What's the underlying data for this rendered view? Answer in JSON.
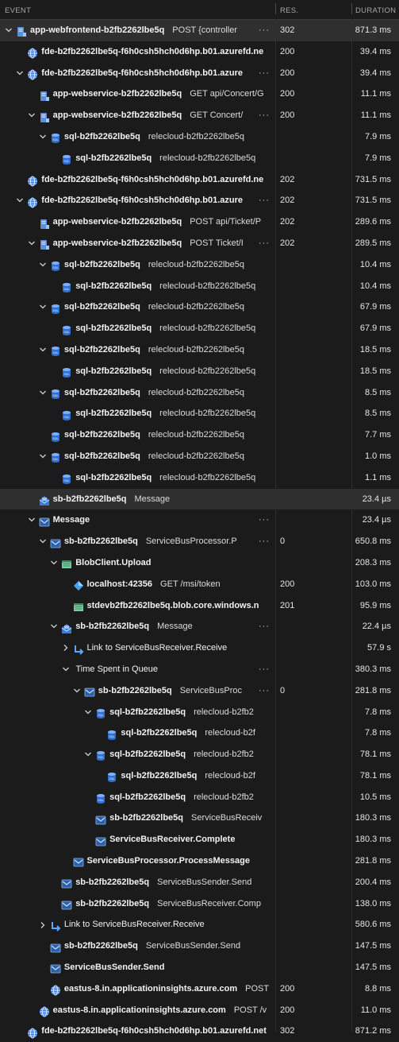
{
  "columns": {
    "event": "EVENT",
    "res": "RES.",
    "duration": "DURATION"
  },
  "rows": [
    {
      "indent": 0,
      "chevron": "down",
      "icon": "app",
      "name": "app-webfrontend-b2fb2262lbe5q",
      "op": "POST {controller",
      "dots": true,
      "res": "302",
      "dur": "871.3 ms",
      "sel": true
    },
    {
      "indent": 1,
      "chevron": "",
      "icon": "globe",
      "name": "fde-b2fb2262lbe5q-f6h0csh5hch0d6hp.b01.azurefd.ne",
      "op": "",
      "dots": false,
      "res": "200",
      "dur": "39.4 ms"
    },
    {
      "indent": 1,
      "chevron": "down",
      "icon": "globe",
      "name": "fde-b2fb2262lbe5q-f6h0csh5hch0d6hp.b01.azure",
      "op": "",
      "dots": true,
      "res": "200",
      "dur": "39.4 ms"
    },
    {
      "indent": 2,
      "chevron": "",
      "icon": "app",
      "name": "app-webservice-b2fb2262lbe5q",
      "op": "GET api/Concert/G",
      "dots": false,
      "res": "200",
      "dur": "11.1 ms"
    },
    {
      "indent": 2,
      "chevron": "down",
      "icon": "app",
      "name": "app-webservice-b2fb2262lbe5q",
      "op": "GET Concert/",
      "dots": true,
      "res": "200",
      "dur": "11.1 ms"
    },
    {
      "indent": 3,
      "chevron": "down",
      "icon": "sql",
      "name": "sql-b2fb2262lbe5q",
      "op": "relecloud-b2fb2262lbe5q",
      "dots": false,
      "res": "",
      "dur": "7.9 ms"
    },
    {
      "indent": 4,
      "chevron": "",
      "icon": "sql",
      "name": "sql-b2fb2262lbe5q",
      "op": "relecloud-b2fb2262lbe5q",
      "dots": false,
      "res": "",
      "dur": "7.9 ms"
    },
    {
      "indent": 1,
      "chevron": "",
      "icon": "globe",
      "name": "fde-b2fb2262lbe5q-f6h0csh5hch0d6hp.b01.azurefd.ne",
      "op": "",
      "dots": false,
      "res": "202",
      "dur": "731.5 ms"
    },
    {
      "indent": 1,
      "chevron": "down",
      "icon": "globe",
      "name": "fde-b2fb2262lbe5q-f6h0csh5hch0d6hp.b01.azure",
      "op": "",
      "dots": true,
      "res": "202",
      "dur": "731.5 ms"
    },
    {
      "indent": 2,
      "chevron": "",
      "icon": "app",
      "name": "app-webservice-b2fb2262lbe5q",
      "op": "POST api/Ticket/P",
      "dots": false,
      "res": "202",
      "dur": "289.6 ms"
    },
    {
      "indent": 2,
      "chevron": "down",
      "icon": "app",
      "name": "app-webservice-b2fb2262lbe5q",
      "op": "POST Ticket/I",
      "dots": true,
      "res": "202",
      "dur": "289.5 ms"
    },
    {
      "indent": 3,
      "chevron": "down",
      "icon": "sql",
      "name": "sql-b2fb2262lbe5q",
      "op": "relecloud-b2fb2262lbe5q",
      "dots": false,
      "res": "",
      "dur": "10.4 ms"
    },
    {
      "indent": 4,
      "chevron": "",
      "icon": "sql",
      "name": "sql-b2fb2262lbe5q",
      "op": "relecloud-b2fb2262lbe5q",
      "dots": false,
      "res": "",
      "dur": "10.4 ms"
    },
    {
      "indent": 3,
      "chevron": "down",
      "icon": "sql",
      "name": "sql-b2fb2262lbe5q",
      "op": "relecloud-b2fb2262lbe5q",
      "dots": false,
      "res": "",
      "dur": "67.9 ms"
    },
    {
      "indent": 4,
      "chevron": "",
      "icon": "sql",
      "name": "sql-b2fb2262lbe5q",
      "op": "relecloud-b2fb2262lbe5q",
      "dots": false,
      "res": "",
      "dur": "67.9 ms"
    },
    {
      "indent": 3,
      "chevron": "down",
      "icon": "sql",
      "name": "sql-b2fb2262lbe5q",
      "op": "relecloud-b2fb2262lbe5q",
      "dots": false,
      "res": "",
      "dur": "18.5 ms"
    },
    {
      "indent": 4,
      "chevron": "",
      "icon": "sql",
      "name": "sql-b2fb2262lbe5q",
      "op": "relecloud-b2fb2262lbe5q",
      "dots": false,
      "res": "",
      "dur": "18.5 ms"
    },
    {
      "indent": 3,
      "chevron": "down",
      "icon": "sql",
      "name": "sql-b2fb2262lbe5q",
      "op": "relecloud-b2fb2262lbe5q",
      "dots": false,
      "res": "",
      "dur": "8.5 ms"
    },
    {
      "indent": 4,
      "chevron": "",
      "icon": "sql",
      "name": "sql-b2fb2262lbe5q",
      "op": "relecloud-b2fb2262lbe5q",
      "dots": false,
      "res": "",
      "dur": "8.5 ms"
    },
    {
      "indent": 3,
      "chevron": "",
      "icon": "sql",
      "name": "sql-b2fb2262lbe5q",
      "op": "relecloud-b2fb2262lbe5q",
      "dots": false,
      "res": "",
      "dur": "7.7 ms"
    },
    {
      "indent": 3,
      "chevron": "down",
      "icon": "sql",
      "name": "sql-b2fb2262lbe5q",
      "op": "relecloud-b2fb2262lbe5q",
      "dots": false,
      "res": "",
      "dur": "1.0 ms"
    },
    {
      "indent": 4,
      "chevron": "",
      "icon": "sql",
      "name": "sql-b2fb2262lbe5q",
      "op": "relecloud-b2fb2262lbe5q",
      "dots": false,
      "res": "",
      "dur": "1.1 ms"
    },
    {
      "indent": 2,
      "chevron": "",
      "icon": "envelope",
      "name": "sb-b2fb2262lbe5q",
      "op": "Message",
      "dots": false,
      "res": "",
      "dur": "23.4 µs",
      "sel": true
    },
    {
      "indent": 2,
      "chevron": "down",
      "icon": "msg",
      "name": "Message",
      "op": "",
      "dots": true,
      "res": "",
      "dur": "23.4 µs"
    },
    {
      "indent": 3,
      "chevron": "down",
      "icon": "msg",
      "name": "sb-b2fb2262lbe5q",
      "op": "ServiceBusProcessor.P",
      "dots": true,
      "res": "0",
      "dur": "650.8 ms"
    },
    {
      "indent": 4,
      "chevron": "down",
      "icon": "blob",
      "name": "BlobClient.Upload",
      "op": "",
      "dots": false,
      "res": "",
      "dur": "208.3 ms"
    },
    {
      "indent": 5,
      "chevron": "",
      "icon": "diamond",
      "name": "localhost:42356",
      "op": "GET /msi/token",
      "dots": false,
      "res": "200",
      "dur": "103.0 ms"
    },
    {
      "indent": 5,
      "chevron": "",
      "icon": "blob",
      "name": "stdevb2fb2262lbe5q.blob.core.windows.n",
      "op": "",
      "dots": false,
      "res": "201",
      "dur": "95.9 ms"
    },
    {
      "indent": 4,
      "chevron": "down",
      "icon": "envelope",
      "name": "sb-b2fb2262lbe5q",
      "op": "Message",
      "dots": true,
      "res": "",
      "dur": "22.4 µs"
    },
    {
      "indent": 5,
      "chevron": "right",
      "icon": "link",
      "name": "Link to ServiceBusReceiver.Receive",
      "op": "",
      "dots": false,
      "res": "",
      "dur": "57.9 s",
      "nb": true
    },
    {
      "indent": 5,
      "chevron": "down",
      "icon": "none",
      "name": "Time Spent in Queue",
      "op": "",
      "dots": true,
      "res": "",
      "dur": "380.3 ms",
      "nb": true
    },
    {
      "indent": 6,
      "chevron": "down",
      "icon": "msg",
      "name": "sb-b2fb2262lbe5q",
      "op": "ServiceBusProc",
      "dots": true,
      "res": "0",
      "dur": "281.8 ms"
    },
    {
      "indent": 7,
      "chevron": "down",
      "icon": "sql",
      "name": "sql-b2fb2262lbe5q",
      "op": "relecloud-b2fb2",
      "dots": false,
      "res": "",
      "dur": "7.8 ms"
    },
    {
      "indent": 8,
      "chevron": "",
      "icon": "sql",
      "name": "sql-b2fb2262lbe5q",
      "op": "relecloud-b2f",
      "dots": false,
      "res": "",
      "dur": "7.8 ms"
    },
    {
      "indent": 7,
      "chevron": "down",
      "icon": "sql",
      "name": "sql-b2fb2262lbe5q",
      "op": "relecloud-b2fb2",
      "dots": false,
      "res": "",
      "dur": "78.1 ms"
    },
    {
      "indent": 8,
      "chevron": "",
      "icon": "sql",
      "name": "sql-b2fb2262lbe5q",
      "op": "relecloud-b2f",
      "dots": false,
      "res": "",
      "dur": "78.1 ms"
    },
    {
      "indent": 7,
      "chevron": "",
      "icon": "sql",
      "name": "sql-b2fb2262lbe5q",
      "op": "relecloud-b2fb2",
      "dots": false,
      "res": "",
      "dur": "10.5 ms"
    },
    {
      "indent": 7,
      "chevron": "",
      "icon": "msg",
      "name": "sb-b2fb2262lbe5q",
      "op": "ServiceBusReceiv",
      "dots": false,
      "res": "",
      "dur": "180.3 ms"
    },
    {
      "indent": 7,
      "chevron": "",
      "icon": "msg",
      "name": "ServiceBusReceiver.Complete",
      "op": "",
      "dots": false,
      "res": "",
      "dur": "180.3 ms"
    },
    {
      "indent": 5,
      "chevron": "",
      "icon": "msg",
      "name": "ServiceBusProcessor.ProcessMessage",
      "op": "",
      "dots": false,
      "res": "",
      "dur": "281.8 ms"
    },
    {
      "indent": 4,
      "chevron": "",
      "icon": "msg",
      "name": "sb-b2fb2262lbe5q",
      "op": "ServiceBusSender.Send",
      "dots": false,
      "res": "",
      "dur": "200.4 ms"
    },
    {
      "indent": 4,
      "chevron": "",
      "icon": "msg",
      "name": "sb-b2fb2262lbe5q",
      "op": "ServiceBusReceiver.Comp",
      "dots": false,
      "res": "",
      "dur": "138.0 ms"
    },
    {
      "indent": 3,
      "chevron": "right",
      "icon": "link",
      "name": "Link to ServiceBusReceiver.Receive",
      "op": "",
      "dots": false,
      "res": "",
      "dur": "580.6 ms",
      "nb": true
    },
    {
      "indent": 3,
      "chevron": "",
      "icon": "msg",
      "name": "sb-b2fb2262lbe5q",
      "op": "ServiceBusSender.Send",
      "dots": false,
      "res": "",
      "dur": "147.5 ms"
    },
    {
      "indent": 3,
      "chevron": "",
      "icon": "msg",
      "name": "ServiceBusSender.Send",
      "op": "",
      "dots": false,
      "res": "",
      "dur": "147.5 ms"
    },
    {
      "indent": 3,
      "chevron": "",
      "icon": "globe",
      "name": "eastus-8.in.applicationinsights.azure.com",
      "op": "POST",
      "dots": false,
      "res": "200",
      "dur": "8.8 ms"
    },
    {
      "indent": 2,
      "chevron": "",
      "icon": "globe",
      "name": "eastus-8.in.applicationinsights.azure.com",
      "op": "POST /v",
      "dots": false,
      "res": "200",
      "dur": "11.0 ms"
    },
    {
      "indent": 1,
      "chevron": "",
      "icon": "globe",
      "name": "fde-b2fb2262lbe5q-f6h0csh5hch0d6hp.b01.azurefd.net",
      "op": "",
      "dots": false,
      "res": "302",
      "dur": "871.2 ms"
    }
  ]
}
